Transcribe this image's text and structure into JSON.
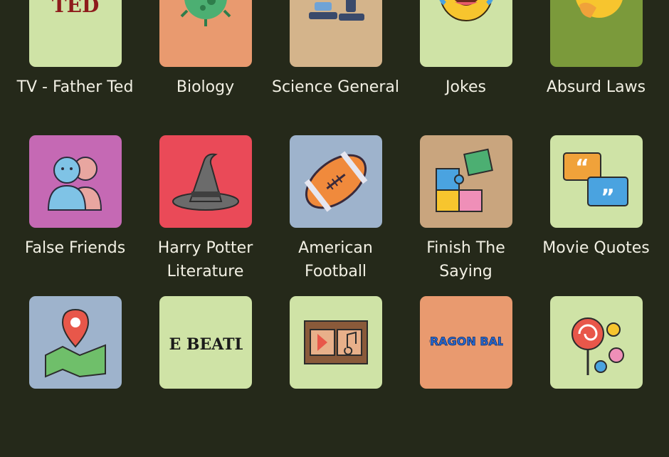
{
  "categories": [
    {
      "label": "TV - Father Ted",
      "bg": "#cfe3a6",
      "icon": "father-ted-logo-icon",
      "logo_text": "TED"
    },
    {
      "label": "Biology",
      "bg": "#e99a6f",
      "icon": "virus-icon"
    },
    {
      "label": "Science General",
      "bg": "#d4b48b",
      "icon": "microscope-icon"
    },
    {
      "label": "Jokes",
      "bg": "#cfe3a6",
      "icon": "laughing-emoji-icon"
    },
    {
      "label": "Absurd Laws",
      "bg": "#7b9a3b",
      "icon": "thinking-emoji-icon"
    },
    {
      "label": "False Friends",
      "bg": "#c569b4",
      "icon": "two-people-icon"
    },
    {
      "label": "Harry Potter\nLiterature",
      "bg": "#ea4a58",
      "icon": "wizard-hat-icon"
    },
    {
      "label": "American\nFootball",
      "bg": "#9eb3cc",
      "icon": "football-icon"
    },
    {
      "label": "Finish The\nSaying",
      "bg": "#c9a57e",
      "icon": "puzzle-icon"
    },
    {
      "label": "Movie Quotes",
      "bg": "#cfe3a6",
      "icon": "speech-bubbles-icon"
    },
    {
      "label": "",
      "bg": "#9eb3cc",
      "icon": "map-pin-icon"
    },
    {
      "label": "",
      "bg": "#cfe3a6",
      "icon": "beatles-logo-icon",
      "logo_text": "THE BEATLES"
    },
    {
      "label": "",
      "bg": "#cfe3a6",
      "icon": "film-strip-icon"
    },
    {
      "label": "",
      "bg": "#e99a6f",
      "icon": "dragon-ball-logo-icon",
      "logo_text": "DRAGON BALL"
    },
    {
      "label": "",
      "bg": "#cfe3a6",
      "icon": "candy-icon"
    }
  ]
}
